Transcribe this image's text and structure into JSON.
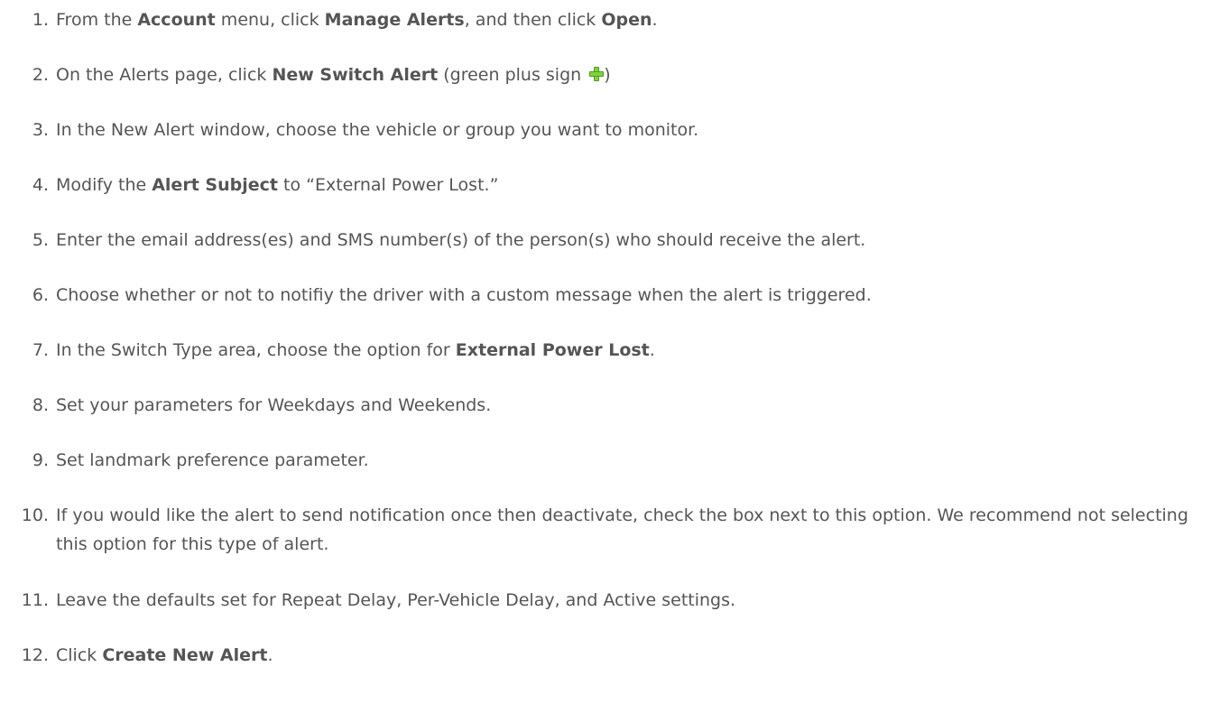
{
  "steps": [
    {
      "number": "1.",
      "parts": [
        "From the ",
        "Account",
        " menu, click ",
        "Manage Alerts",
        ", and then click ",
        "Open",
        "."
      ]
    },
    {
      "number": "2.",
      "parts": [
        "On the Alerts page, click ",
        "New Switch Alert",
        " (green plus sign ",
        ")"
      ],
      "icon": "green-plus-icon",
      "icon_color": "#7fd43a"
    },
    {
      "number": "3.",
      "text": "In the New Alert window, choose the vehicle or group you want to monitor."
    },
    {
      "number": "4.",
      "parts": [
        "Modify the ",
        "Alert Subject",
        " to “External Power Lost.”"
      ]
    },
    {
      "number": "5.",
      "text": "Enter the email address(es) and SMS number(s) of the person(s) who should receive the alert."
    },
    {
      "number": "6.",
      "text": "Choose whether or not to notifiy the driver with a custom message when the alert is triggered."
    },
    {
      "number": "7.",
      "parts": [
        "In the Switch Type area, choose the option for ",
        "External Power Lost",
        "."
      ]
    },
    {
      "number": "8.",
      "text": "Set your parameters for Weekdays and Weekends."
    },
    {
      "number": "9.",
      "text": "Set landmark preference parameter."
    },
    {
      "number": "10.",
      "text": "If you would like the alert to send notification once then deactivate, check the box next to this option. We recommend not selecting this option for this type of alert."
    },
    {
      "number": "11.",
      "text": "Leave the defaults set for Repeat Delay, Per-Vehicle Delay, and Active settings."
    },
    {
      "number": "12.",
      "parts": [
        "Click ",
        "Create New Alert",
        "."
      ]
    }
  ]
}
